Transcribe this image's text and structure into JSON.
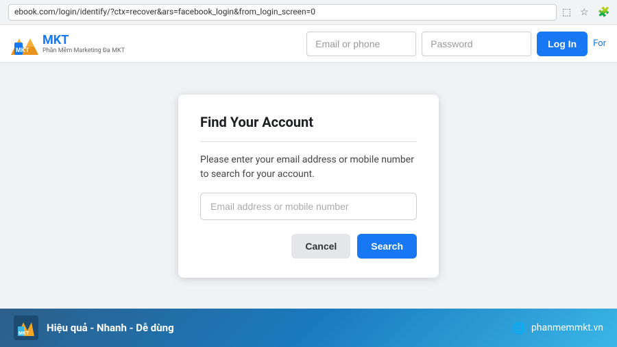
{
  "browser": {
    "url": "ebook.com/login/identify/?ctx=recover&ars=facebook_login&from_login_screen=0"
  },
  "navbar": {
    "logo_text": "MKT",
    "logo_subtext": "Phần Mềm Marketing Đa MKT",
    "email_placeholder": "Email or phone",
    "password_placeholder": "Password",
    "login_label": "Log In",
    "forgot_label": "For"
  },
  "dialog": {
    "title": "Find Your Account",
    "description": "Please enter your email address or mobile number to search for your account.",
    "input_placeholder": "Email address or mobile number",
    "cancel_label": "Cancel",
    "search_label": "Search"
  },
  "footer": {
    "logo_text": "MKT",
    "tagline": "Hiệu quả - Nhanh  - Dễ dùng",
    "website": "phanmemmkt.vn"
  }
}
